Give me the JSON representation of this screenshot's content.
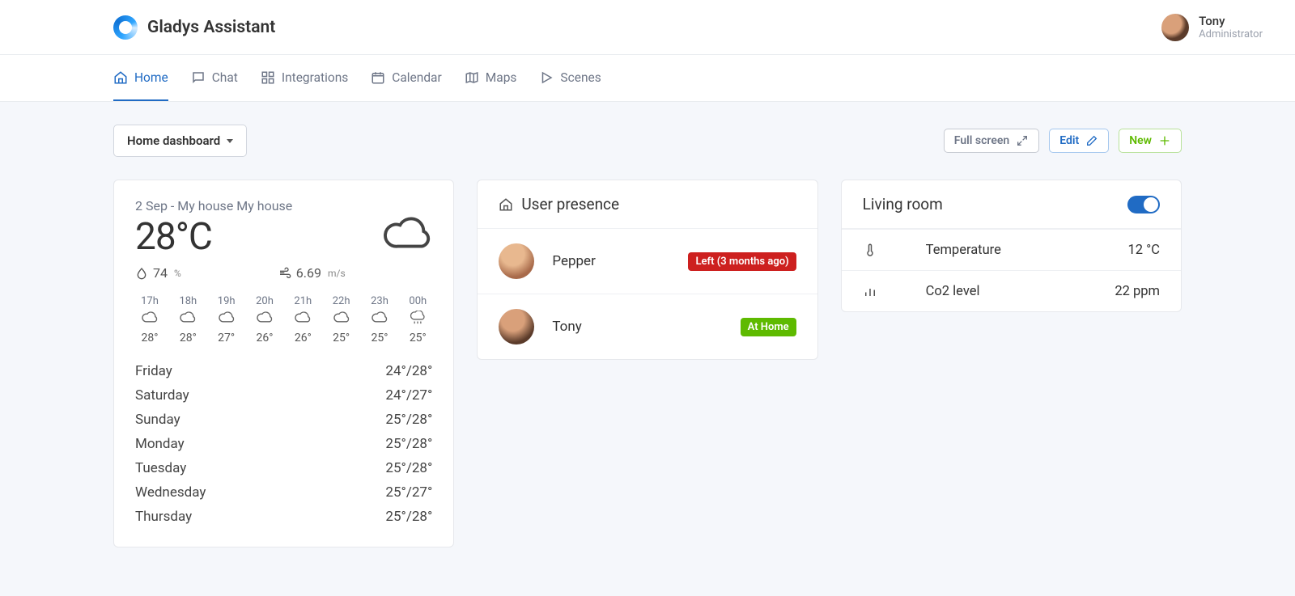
{
  "brand": "Gladys Assistant",
  "user": {
    "name": "Tony",
    "role": "Administrator"
  },
  "nav": {
    "home": "Home",
    "chat": "Chat",
    "integrations": "Integrations",
    "calendar": "Calendar",
    "maps": "Maps",
    "scenes": "Scenes"
  },
  "toolbar": {
    "dashboard_label": "Home dashboard",
    "fullscreen": "Full screen",
    "edit": "Edit",
    "new": "New"
  },
  "weather": {
    "date_line": "2 Sep - My house My house",
    "temp": "28°C",
    "humidity_value": "74",
    "humidity_unit": "%",
    "wind_value": "6.69",
    "wind_unit": "m/s",
    "hourly": [
      {
        "h": "17h",
        "t": "28°",
        "icon": "cloud"
      },
      {
        "h": "18h",
        "t": "28°",
        "icon": "cloud"
      },
      {
        "h": "19h",
        "t": "27°",
        "icon": "cloud"
      },
      {
        "h": "20h",
        "t": "26°",
        "icon": "cloud"
      },
      {
        "h": "21h",
        "t": "26°",
        "icon": "cloud"
      },
      {
        "h": "22h",
        "t": "25°",
        "icon": "cloud"
      },
      {
        "h": "23h",
        "t": "25°",
        "icon": "cloud"
      },
      {
        "h": "00h",
        "t": "25°",
        "icon": "rain"
      }
    ],
    "daily": [
      {
        "d": "Friday",
        "t": "24°/28°"
      },
      {
        "d": "Saturday",
        "t": "24°/27°"
      },
      {
        "d": "Sunday",
        "t": "25°/28°"
      },
      {
        "d": "Monday",
        "t": "25°/28°"
      },
      {
        "d": "Tuesday",
        "t": "25°/28°"
      },
      {
        "d": "Wednesday",
        "t": "25°/27°"
      },
      {
        "d": "Thursday",
        "t": "25°/28°"
      }
    ]
  },
  "presence": {
    "title": "User presence",
    "users": [
      {
        "name": "Pepper",
        "status": "Left (3 months ago)",
        "state": "away"
      },
      {
        "name": "Tony",
        "status": "At Home",
        "state": "home"
      }
    ]
  },
  "room": {
    "title": "Living room",
    "rows": [
      {
        "icon": "thermo",
        "label": "Temperature",
        "value": "12 °C"
      },
      {
        "icon": "bars",
        "label": "Co2 level",
        "value": "22 ppm"
      }
    ]
  }
}
